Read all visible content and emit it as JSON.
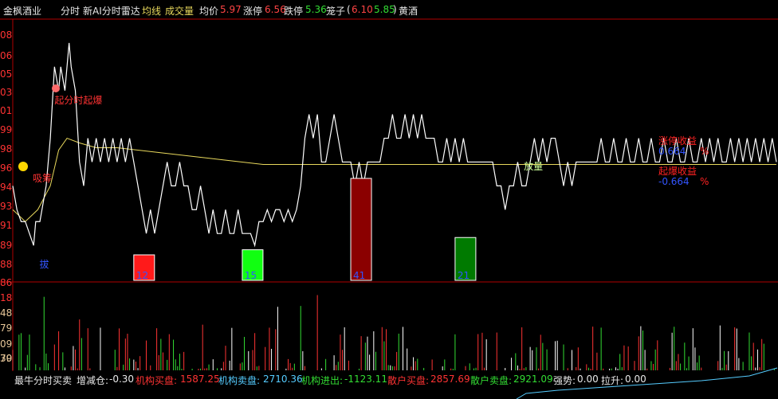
{
  "header": {
    "stock_name": "金枫酒业",
    "mode": "分时",
    "indicator": "新AI分时雷达",
    "ma_label": "均线",
    "vol_label": "成交量",
    "avg_label": "均价",
    "avg_value": "5.97",
    "limit_up_label": "涨停",
    "limit_up_value": "6.56",
    "limit_down_label": "跌停",
    "limit_down_value": "5.36",
    "cage_label": "笼子",
    "cage_open": "(",
    "cage_high": "6.10",
    "cage_low": "5.85",
    "cage_close": ")",
    "sector": "黄酒"
  },
  "footer": {
    "title": "最牛分时买卖",
    "change_label": "增减仓:",
    "change_value": "-0.30",
    "inst_buy_label": "机构买盘:",
    "inst_buy_value": "1587.25",
    "inst_sell_label": "机构卖盘:",
    "inst_sell_value": "2710.36",
    "inst_net_label": "机构进出:",
    "inst_net_value": "-1123.11",
    "retail_buy_label": "散户买盘:",
    "retail_buy_value": "2857.69",
    "retail_sell_label": "散户卖盘:",
    "retail_sell_value": "2921.09",
    "strength_label": "强势:",
    "strength_value": "0.00",
    "pull_label": "拉升:",
    "pull_value": "0.00"
  },
  "colors": {
    "price_line": "#ffffff",
    "avg_line": "#e8d85c",
    "up": "#ff3333",
    "down": "#33dd33",
    "flat": "#ffffff",
    "label_blue": "#3355ff"
  },
  "chart_data": {
    "type": "line",
    "y_tick_labels": [
      "08",
      "06",
      "05",
      "03",
      "01",
      "99",
      "98",
      "96",
      "94",
      "93",
      "91",
      "89",
      "88",
      "86",
      "18",
      "48",
      "79",
      "09",
      "39",
      "70"
    ],
    "price_series": [
      {
        "x": 0,
        "y": 5.96
      },
      {
        "x": 2,
        "y": 5.95
      },
      {
        "x": 4,
        "y": 5.945
      },
      {
        "x": 6,
        "y": 5.945
      },
      {
        "x": 8,
        "y": 5.94
      },
      {
        "x": 10,
        "y": 5.935
      },
      {
        "x": 11,
        "y": 5.945
      },
      {
        "x": 13,
        "y": 5.945
      },
      {
        "x": 16,
        "y": 5.96
      },
      {
        "x": 18,
        "y": 5.98
      },
      {
        "x": 20,
        "y": 6.01
      },
      {
        "x": 22,
        "y": 6.0
      },
      {
        "x": 23,
        "y": 6.01
      },
      {
        "x": 25,
        "y": 6.0
      },
      {
        "x": 27,
        "y": 6.02
      },
      {
        "x": 28,
        "y": 6.01
      },
      {
        "x": 30,
        "y": 6.0
      },
      {
        "x": 32,
        "y": 5.97
      },
      {
        "x": 34,
        "y": 5.96
      },
      {
        "x": 36,
        "y": 5.98
      },
      {
        "x": 38,
        "y": 5.97
      },
      {
        "x": 40,
        "y": 5.98
      },
      {
        "x": 42,
        "y": 5.97
      },
      {
        "x": 44,
        "y": 5.98
      },
      {
        "x": 46,
        "y": 5.97
      },
      {
        "x": 48,
        "y": 5.98
      },
      {
        "x": 50,
        "y": 5.97
      },
      {
        "x": 52,
        "y": 5.98
      },
      {
        "x": 54,
        "y": 5.97
      },
      {
        "x": 56,
        "y": 5.98
      },
      {
        "x": 58,
        "y": 5.97
      },
      {
        "x": 60,
        "y": 5.96
      },
      {
        "x": 62,
        "y": 5.95
      },
      {
        "x": 64,
        "y": 5.94
      },
      {
        "x": 66,
        "y": 5.95
      },
      {
        "x": 68,
        "y": 5.94
      },
      {
        "x": 70,
        "y": 5.95
      },
      {
        "x": 72,
        "y": 5.96
      },
      {
        "x": 74,
        "y": 5.97
      },
      {
        "x": 76,
        "y": 5.96
      },
      {
        "x": 78,
        "y": 5.96
      },
      {
        "x": 80,
        "y": 5.97
      },
      {
        "x": 82,
        "y": 5.96
      },
      {
        "x": 84,
        "y": 5.96
      },
      {
        "x": 86,
        "y": 5.95
      },
      {
        "x": 88,
        "y": 5.95
      },
      {
        "x": 90,
        "y": 5.96
      },
      {
        "x": 92,
        "y": 5.95
      },
      {
        "x": 94,
        "y": 5.94
      },
      {
        "x": 96,
        "y": 5.95
      },
      {
        "x": 98,
        "y": 5.94
      },
      {
        "x": 100,
        "y": 5.94
      },
      {
        "x": 102,
        "y": 5.95
      },
      {
        "x": 104,
        "y": 5.94
      },
      {
        "x": 106,
        "y": 5.94
      },
      {
        "x": 108,
        "y": 5.95
      },
      {
        "x": 110,
        "y": 5.94
      },
      {
        "x": 112,
        "y": 5.94
      },
      {
        "x": 114,
        "y": 5.94
      },
      {
        "x": 116,
        "y": 5.935
      },
      {
        "x": 118,
        "y": 5.945
      },
      {
        "x": 120,
        "y": 5.945
      },
      {
        "x": 122,
        "y": 5.95
      },
      {
        "x": 124,
        "y": 5.945
      },
      {
        "x": 126,
        "y": 5.95
      },
      {
        "x": 128,
        "y": 5.95
      },
      {
        "x": 130,
        "y": 5.945
      },
      {
        "x": 132,
        "y": 5.95
      },
      {
        "x": 134,
        "y": 5.945
      },
      {
        "x": 136,
        "y": 5.95
      },
      {
        "x": 138,
        "y": 5.96
      },
      {
        "x": 140,
        "y": 5.98
      },
      {
        "x": 142,
        "y": 5.99
      },
      {
        "x": 144,
        "y": 5.98
      },
      {
        "x": 146,
        "y": 5.99
      },
      {
        "x": 148,
        "y": 5.97
      },
      {
        "x": 150,
        "y": 5.97
      },
      {
        "x": 152,
        "y": 5.98
      },
      {
        "x": 154,
        "y": 5.99
      },
      {
        "x": 156,
        "y": 5.98
      },
      {
        "x": 158,
        "y": 5.97
      },
      {
        "x": 160,
        "y": 5.97
      },
      {
        "x": 162,
        "y": 5.97
      },
      {
        "x": 164,
        "y": 5.96
      },
      {
        "x": 166,
        "y": 5.97
      },
      {
        "x": 168,
        "y": 5.96
      },
      {
        "x": 170,
        "y": 5.97
      },
      {
        "x": 172,
        "y": 5.97
      },
      {
        "x": 174,
        "y": 5.97
      },
      {
        "x": 176,
        "y": 5.97
      },
      {
        "x": 178,
        "y": 5.98
      },
      {
        "x": 180,
        "y": 5.98
      },
      {
        "x": 182,
        "y": 5.99
      },
      {
        "x": 184,
        "y": 5.98
      },
      {
        "x": 186,
        "y": 5.98
      },
      {
        "x": 188,
        "y": 5.99
      },
      {
        "x": 190,
        "y": 5.98
      },
      {
        "x": 192,
        "y": 5.99
      },
      {
        "x": 194,
        "y": 5.98
      },
      {
        "x": 196,
        "y": 5.99
      },
      {
        "x": 198,
        "y": 5.98
      },
      {
        "x": 200,
        "y": 5.98
      },
      {
        "x": 202,
        "y": 5.98
      },
      {
        "x": 204,
        "y": 5.97
      },
      {
        "x": 206,
        "y": 5.97
      },
      {
        "x": 208,
        "y": 5.98
      },
      {
        "x": 210,
        "y": 5.97
      },
      {
        "x": 212,
        "y": 5.98
      },
      {
        "x": 214,
        "y": 5.97
      },
      {
        "x": 216,
        "y": 5.98
      },
      {
        "x": 218,
        "y": 5.97
      },
      {
        "x": 220,
        "y": 5.97
      },
      {
        "x": 222,
        "y": 5.97
      },
      {
        "x": 224,
        "y": 5.97
      },
      {
        "x": 226,
        "y": 5.97
      },
      {
        "x": 228,
        "y": 5.97
      },
      {
        "x": 230,
        "y": 5.97
      },
      {
        "x": 232,
        "y": 5.96
      },
      {
        "x": 234,
        "y": 5.96
      },
      {
        "x": 236,
        "y": 5.95
      },
      {
        "x": 238,
        "y": 5.96
      },
      {
        "x": 240,
        "y": 5.96
      },
      {
        "x": 242,
        "y": 5.97
      },
      {
        "x": 244,
        "y": 5.96
      },
      {
        "x": 246,
        "y": 5.96
      },
      {
        "x": 248,
        "y": 5.97
      },
      {
        "x": 250,
        "y": 5.98
      },
      {
        "x": 252,
        "y": 5.97
      },
      {
        "x": 254,
        "y": 5.98
      },
      {
        "x": 256,
        "y": 5.97
      },
      {
        "x": 258,
        "y": 5.98
      },
      {
        "x": 260,
        "y": 5.98
      },
      {
        "x": 262,
        "y": 5.97
      },
      {
        "x": 264,
        "y": 5.96
      },
      {
        "x": 266,
        "y": 5.97
      },
      {
        "x": 268,
        "y": 5.96
      },
      {
        "x": 270,
        "y": 5.97
      },
      {
        "x": 272,
        "y": 5.97
      },
      {
        "x": 274,
        "y": 5.97
      },
      {
        "x": 276,
        "y": 5.97
      },
      {
        "x": 278,
        "y": 5.97
      },
      {
        "x": 280,
        "y": 5.97
      },
      {
        "x": 282,
        "y": 5.98
      },
      {
        "x": 284,
        "y": 5.97
      },
      {
        "x": 286,
        "y": 5.97
      },
      {
        "x": 288,
        "y": 5.98
      },
      {
        "x": 290,
        "y": 5.97
      },
      {
        "x": 292,
        "y": 5.97
      },
      {
        "x": 294,
        "y": 5.98
      },
      {
        "x": 296,
        "y": 5.97
      },
      {
        "x": 298,
        "y": 5.97
      },
      {
        "x": 300,
        "y": 5.98
      },
      {
        "x": 302,
        "y": 5.97
      },
      {
        "x": 304,
        "y": 5.97
      },
      {
        "x": 306,
        "y": 5.98
      },
      {
        "x": 308,
        "y": 5.97
      },
      {
        "x": 310,
        "y": 5.97
      },
      {
        "x": 312,
        "y": 5.98
      },
      {
        "x": 314,
        "y": 5.97
      },
      {
        "x": 316,
        "y": 5.97
      },
      {
        "x": 318,
        "y": 5.98
      },
      {
        "x": 320,
        "y": 5.97
      },
      {
        "x": 322,
        "y": 5.97
      },
      {
        "x": 324,
        "y": 5.98
      },
      {
        "x": 326,
        "y": 5.97
      },
      {
        "x": 328,
        "y": 5.97
      },
      {
        "x": 330,
        "y": 5.98
      },
      {
        "x": 332,
        "y": 5.97
      },
      {
        "x": 334,
        "y": 5.98
      },
      {
        "x": 336,
        "y": 5.97
      },
      {
        "x": 338,
        "y": 5.98
      },
      {
        "x": 340,
        "y": 5.97
      },
      {
        "x": 342,
        "y": 5.97
      },
      {
        "x": 344,
        "y": 5.98
      },
      {
        "x": 346,
        "y": 5.97
      },
      {
        "x": 348,
        "y": 5.98
      },
      {
        "x": 350,
        "y": 5.97
      },
      {
        "x": 352,
        "y": 5.98
      },
      {
        "x": 354,
        "y": 5.97
      },
      {
        "x": 356,
        "y": 5.98
      },
      {
        "x": 358,
        "y": 5.97
      },
      {
        "x": 360,
        "y": 5.98
      },
      {
        "x": 362,
        "y": 5.97
      },
      {
        "x": 364,
        "y": 5.98
      },
      {
        "x": 366,
        "y": 5.97
      }
    ],
    "avg_series": [
      {
        "x": 0,
        "y": 5.95
      },
      {
        "x": 6,
        "y": 5.945
      },
      {
        "x": 12,
        "y": 5.95
      },
      {
        "x": 18,
        "y": 5.96
      },
      {
        "x": 22,
        "y": 5.975
      },
      {
        "x": 26,
        "y": 5.98
      },
      {
        "x": 32,
        "y": 5.978
      },
      {
        "x": 40,
        "y": 5.976
      },
      {
        "x": 50,
        "y": 5.976
      },
      {
        "x": 60,
        "y": 5.975
      },
      {
        "x": 70,
        "y": 5.974
      },
      {
        "x": 80,
        "y": 5.973
      },
      {
        "x": 90,
        "y": 5.972
      },
      {
        "x": 100,
        "y": 5.971
      },
      {
        "x": 110,
        "y": 5.97
      },
      {
        "x": 120,
        "y": 5.969
      },
      {
        "x": 130,
        "y": 5.969
      },
      {
        "x": 140,
        "y": 5.969
      },
      {
        "x": 160,
        "y": 5.969
      },
      {
        "x": 200,
        "y": 5.969
      },
      {
        "x": 240,
        "y": 5.969
      },
      {
        "x": 280,
        "y": 5.969
      },
      {
        "x": 320,
        "y": 5.969
      },
      {
        "x": 366,
        "y": 5.969
      }
    ],
    "y_price_range": [
      5.92,
      6.03
    ],
    "x_range": [
      0,
      366
    ],
    "signals": [
      {
        "label": "起分时起爆",
        "x": 20
      },
      {
        "label": "吸筹",
        "x": 8
      },
      {
        "label": "放量",
        "x": 248
      },
      {
        "label": "拔",
        "x": 12
      }
    ],
    "signal_bars": [
      {
        "x": 58,
        "value": 12,
        "height": 0.25,
        "color": "red"
      },
      {
        "x": 110,
        "value": 15,
        "height": 0.3,
        "color": "green"
      },
      {
        "x": 162,
        "value": 41,
        "height": 1.0,
        "color": "darkred"
      },
      {
        "x": 212,
        "value": 21,
        "height": 0.42,
        "color": "darkgreen"
      }
    ],
    "right_labels": [
      {
        "label": "涨停收益",
        "value": "0.664",
        "unit": "%"
      },
      {
        "label": "起爆收益",
        "value": "-0.664",
        "unit": "%"
      }
    ],
    "volume_seed": 7
  }
}
